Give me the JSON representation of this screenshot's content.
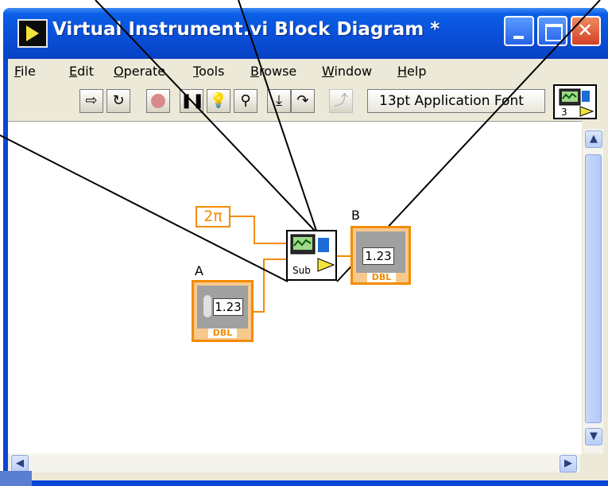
{
  "window": {
    "title": "Virtual Instrument.vi Block Diagram *"
  },
  "menu": {
    "items": [
      {
        "underline": "F",
        "rest": "ile"
      },
      {
        "underline": "E",
        "rest": "dit"
      },
      {
        "underline": "O",
        "rest": "perate"
      },
      {
        "underline": "T",
        "rest": "ools"
      },
      {
        "underline": "B",
        "rest": "rowse"
      },
      {
        "underline": "W",
        "rest": "indow"
      },
      {
        "underline": "H",
        "rest": "elp"
      }
    ]
  },
  "toolbar": {
    "font_label": "13pt Application Font"
  },
  "vi_icon": {
    "connector_count": "3"
  },
  "diagram": {
    "constant_label": "2π",
    "control_label": "A",
    "indicator_label": "B",
    "control_value": "1.23",
    "indicator_value": "1.23",
    "control_type": "DBL",
    "indicator_type": "DBL",
    "subvi_label": "Sub"
  }
}
